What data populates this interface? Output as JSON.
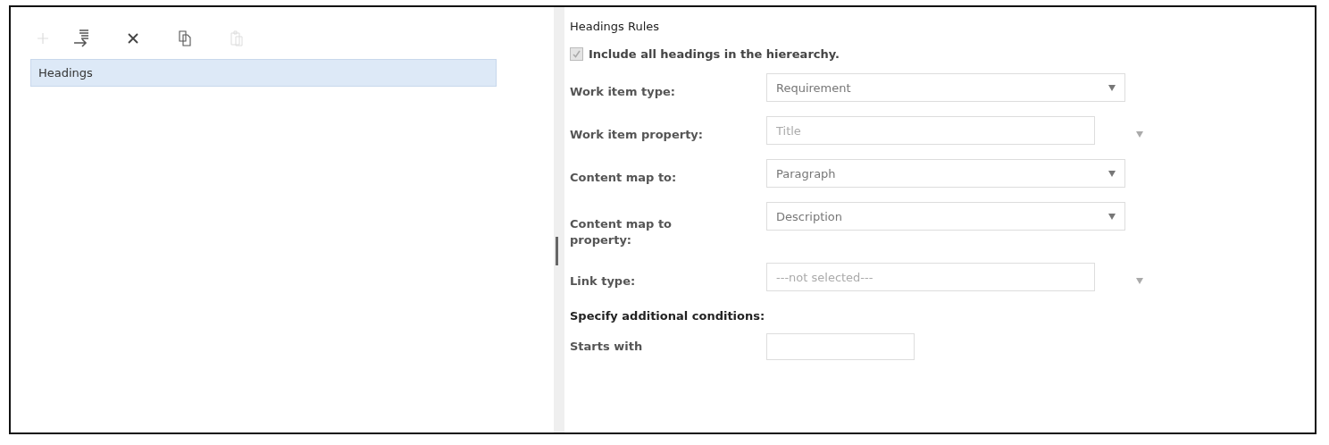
{
  "toolbar": [
    {
      "kind": "add",
      "disabled": true
    },
    {
      "kind": "indent",
      "disabled": false
    },
    {
      "kind": "delete",
      "disabled": false
    },
    {
      "kind": "copy",
      "disabled": false
    },
    {
      "kind": "paste",
      "disabled": true
    }
  ],
  "tree": {
    "items": [
      {
        "label": "Headings",
        "selected": true
      }
    ]
  },
  "rules": {
    "title": "Headings Rules",
    "include_all": {
      "label": "Include all headings in the hierearchy.",
      "checked": true,
      "disabled": true
    },
    "fields": [
      {
        "kind": "dropdown",
        "label": "Work item type:",
        "value": "Requirement",
        "disabled": false
      },
      {
        "kind": "dropdown",
        "label": "Work item property:",
        "value": "Title",
        "disabled": true
      },
      {
        "kind": "dropdown",
        "label": "Content map to:",
        "value": "Paragraph",
        "disabled": false
      },
      {
        "kind": "dropdown",
        "label": "Content map to property:",
        "value": "Description",
        "disabled": false
      },
      {
        "kind": "dropdown",
        "label": "Link type:",
        "value": "---not selected---",
        "disabled": true
      }
    ],
    "conditions_title": "Specify additional conditions:",
    "conditions": [
      {
        "kind": "text",
        "label": "Starts with"
      }
    ]
  }
}
